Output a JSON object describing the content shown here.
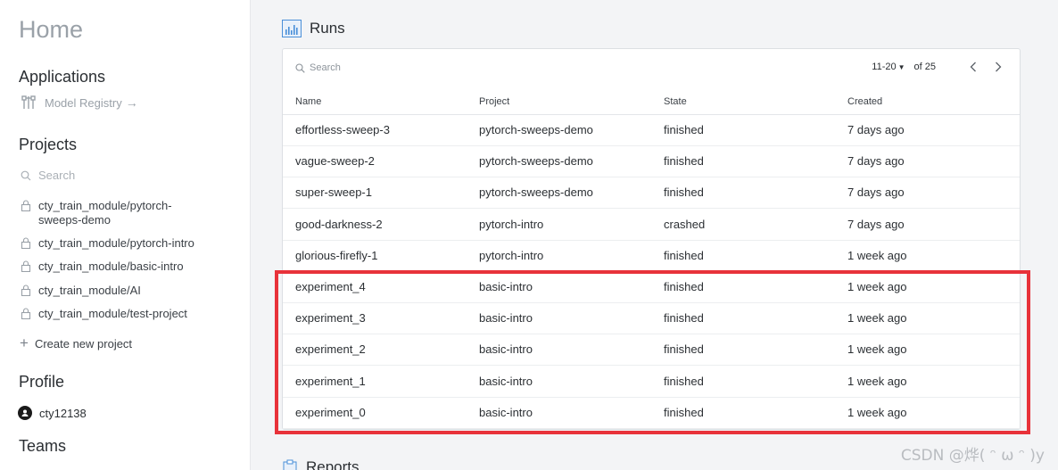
{
  "sidebar": {
    "home_title": "Home",
    "applications_title": "Applications",
    "model_registry_label": "Model Registry",
    "arrow": "→",
    "projects_title": "Projects",
    "search_placeholder": "Search",
    "projects": [
      {
        "line1": "cty_train_module/pytorch-",
        "line2": "sweeps-demo"
      },
      {
        "line1": "cty_train_module/pytorch-intro",
        "line2": ""
      },
      {
        "line1": "cty_train_module/basic-intro",
        "line2": ""
      },
      {
        "line1": "cty_train_module/AI",
        "line2": ""
      },
      {
        "line1": "cty_train_module/test-project",
        "line2": ""
      }
    ],
    "create_label": "Create new project",
    "profile_title": "Profile",
    "username": "cty12138",
    "teams_title": "Teams"
  },
  "runs": {
    "title": "Runs",
    "search_placeholder": "Search",
    "pager_range": "11-20",
    "pager_of": "of 25",
    "columns": [
      "Name",
      "Project",
      "State",
      "Created"
    ],
    "rows": [
      [
        "effortless-sweep-3",
        "pytorch-sweeps-demo",
        "finished",
        "7 days ago"
      ],
      [
        "vague-sweep-2",
        "pytorch-sweeps-demo",
        "finished",
        "7 days ago"
      ],
      [
        "super-sweep-1",
        "pytorch-sweeps-demo",
        "finished",
        "7 days ago"
      ],
      [
        "good-darkness-2",
        "pytorch-intro",
        "crashed",
        "7 days ago"
      ],
      [
        "glorious-firefly-1",
        "pytorch-intro",
        "finished",
        "1 week ago"
      ],
      [
        "experiment_4",
        "basic-intro",
        "finished",
        "1 week ago"
      ],
      [
        "experiment_3",
        "basic-intro",
        "finished",
        "1 week ago"
      ],
      [
        "experiment_2",
        "basic-intro",
        "finished",
        "1 week ago"
      ],
      [
        "experiment_1",
        "basic-intro",
        "finished",
        "1 week ago"
      ],
      [
        "experiment_0",
        "basic-intro",
        "finished",
        "1 week ago"
      ]
    ]
  },
  "reports": {
    "title": "Reports"
  },
  "watermark": "CSDN @烨( ᵔ ω ᵔ )y",
  "colors": {
    "highlight": "#e8323a",
    "accent": "#4a8fd8"
  },
  "icons": {
    "runs": "chart-icon",
    "reports": "clipboard-icon",
    "lock": "lock-icon",
    "search": "search-icon"
  }
}
